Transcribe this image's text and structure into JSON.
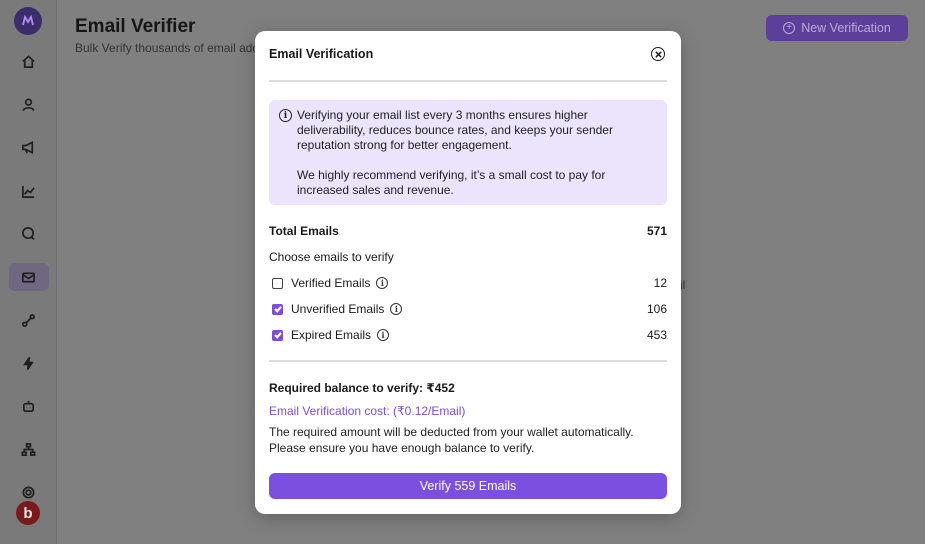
{
  "background": {
    "title": "Email Verifier",
    "subtitle": "Bulk Verify thousands of email addresses",
    "new_button_label": "New Verification",
    "empty_fragment": "il",
    "avatar_letter": "b"
  },
  "modal": {
    "title": "Email Verification",
    "info": {
      "paragraph1": "Verifying your email list every 3 months ensures higher deliverability, reduces bounce rates, and keeps your sender reputation strong for better engagement.",
      "paragraph2": "We highly recommend verifying, it’s a small cost to pay for increased sales and revenue."
    },
    "total_label": "Total Emails",
    "total_value": "571",
    "choose_label": "Choose emails to verify",
    "options": [
      {
        "label": "Verified Emails",
        "count": "12",
        "checked": false
      },
      {
        "label": "Unverified Emails",
        "count": "106",
        "checked": true
      },
      {
        "label": "Expired Emails",
        "count": "453",
        "checked": true
      }
    ],
    "required_balance": "Required balance to verify: ₹452",
    "cost_text": "Email Verification cost: (₹0.12/Email)",
    "note": "The required amount will be deducted from your wallet automatically. Please ensure you have enough balance to verify.",
    "verify_button": "Verify 559 Emails"
  },
  "colors": {
    "accent": "#7b4fe0",
    "info_bg": "#ece3fc"
  }
}
